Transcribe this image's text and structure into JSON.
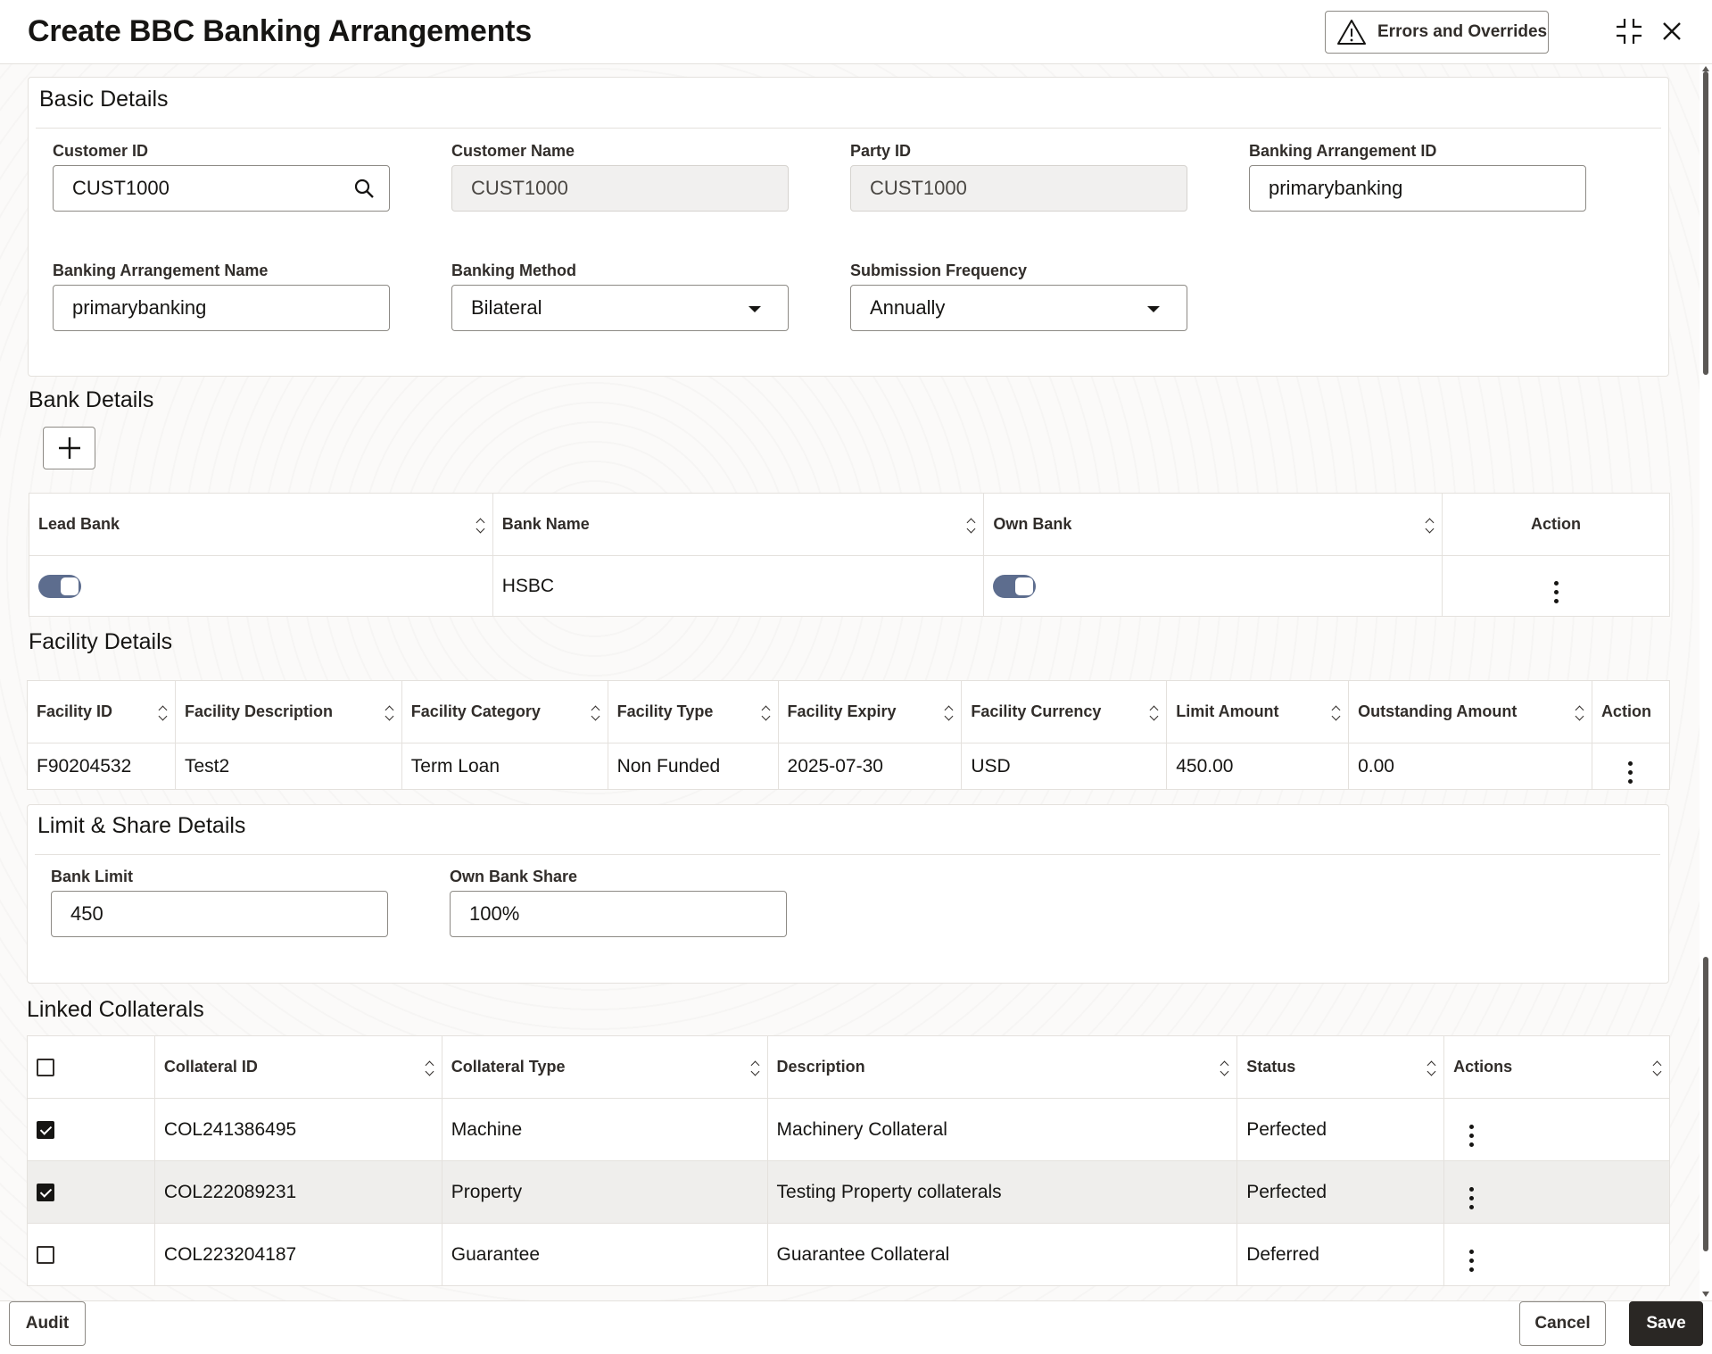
{
  "header": {
    "title": "Create BBC Banking Arrangements",
    "errors_button": "Errors and Overrides"
  },
  "basic_details": {
    "title": "Basic Details",
    "customer_id": {
      "label": "Customer ID",
      "value": "CUST1000"
    },
    "customer_name": {
      "label": "Customer Name",
      "value": "CUST1000"
    },
    "party_id": {
      "label": "Party ID",
      "value": "CUST1000"
    },
    "arrangement_id": {
      "label": "Banking Arrangement ID",
      "value": "primarybanking"
    },
    "arrangement_name": {
      "label": "Banking Arrangement Name",
      "value": "primarybanking"
    },
    "banking_method": {
      "label": "Banking Method",
      "value": "Bilateral"
    },
    "submission_frequency": {
      "label": "Submission Frequency",
      "value": "Annually"
    }
  },
  "bank_details": {
    "title": "Bank Details",
    "columns": [
      "Lead Bank",
      "Bank Name",
      "Own Bank",
      "Action"
    ],
    "rows": [
      {
        "lead_bank": true,
        "bank_name": "HSBC",
        "own_bank": true
      }
    ]
  },
  "facility_details": {
    "title": "Facility Details",
    "columns": [
      "Facility ID",
      "Facility Description",
      "Facility Category",
      "Facility Type",
      "Facility Expiry",
      "Facility Currency",
      "Limit Amount",
      "Outstanding Amount",
      "Action"
    ],
    "rows": [
      [
        "F90204532",
        "Test2",
        "Term Loan",
        "Non Funded",
        "2025-07-30",
        "USD",
        "450.00",
        "0.00"
      ]
    ]
  },
  "limit_share": {
    "title": "Limit & Share Details",
    "bank_limit": {
      "label": "Bank Limit",
      "value": "450"
    },
    "own_bank_share": {
      "label": "Own Bank Share",
      "value": "100%"
    }
  },
  "linked_collaterals": {
    "title": "Linked Collaterals",
    "columns": [
      "Collateral ID",
      "Collateral Type",
      "Description",
      "Status",
      "Actions"
    ],
    "rows": [
      {
        "checked": true,
        "cells": [
          "COL241386495",
          "Machine",
          "Machinery Collateral",
          "Perfected"
        ]
      },
      {
        "checked": true,
        "cells": [
          "COL222089231",
          "Property",
          "Testing Property collaterals",
          "Perfected"
        ]
      },
      {
        "checked": false,
        "cells": [
          "COL223204187",
          "Guarantee",
          "Guarantee Collateral",
          "Deferred"
        ]
      }
    ]
  },
  "footer": {
    "audit": "Audit",
    "cancel": "Cancel",
    "save": "Save"
  },
  "icons": {
    "errors": "warning-triangle-icon",
    "minimize": "minimize-icon",
    "close": "close-icon",
    "search": "search-icon",
    "add": "plus-icon"
  }
}
